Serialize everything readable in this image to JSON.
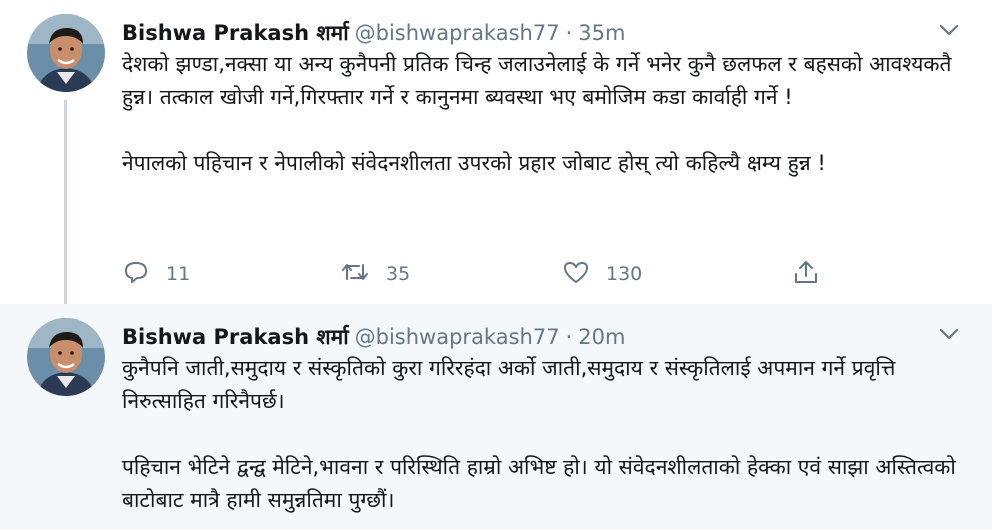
{
  "tweets": [
    {
      "author_name": "Bishwa Prakash शर्मा",
      "handle": "@bishwaprakash77",
      "separator": "·",
      "time": "35m",
      "paragraphs": [
        "देशको झण्डा,नक्सा या अन्य कुनैपनी प्रतिक चिन्ह जलाउनेलाई के गर्ने भनेर कुनै छलफल र बहसको आवश्यकतै हुन्न। तत्काल खोजी गर्ने,गिरफ्तार गर्ने र कानुनमा ब्यवस्था भए बमोजिम कडा कार्वाही गर्ने !",
        "नेपालको पहिचान र नेपालीको संवेदनशीलता उपरको प्रहार जोबाट होस् त्यो कहिल्यै क्षम्य हुन्न !"
      ],
      "replies": "11",
      "retweets": "35",
      "likes": "130"
    },
    {
      "author_name": "Bishwa Prakash शर्मा",
      "handle": "@bishwaprakash77",
      "separator": "·",
      "time": "20m",
      "paragraphs": [
        "कुनैपनि जाती,समुदाय र संस्कृतिको कुरा गरिरहंदा अर्को जाती,समुदाय र संस्कृतिलाई अपमान गर्ने प्रवृत्ति निरुत्साहित गरिनैपर्छ।",
        "पहिचान भेटिने द्वन्द्व मेटिने,भावना र परिस्थिति हाम्रो अभिष्ट हो। यो संवेदनशीलताको हेक्का एवं साझा अस्तित्वको बाटोबाट मात्रै हामी समुन्नतिमा पुग्छौं।"
      ]
    }
  ],
  "icons": {
    "reply": "reply-icon",
    "retweet": "retweet-icon",
    "like": "heart-icon",
    "share": "share-icon",
    "caret": "chevron-down-icon"
  },
  "colors": {
    "text": "#14171a",
    "muted": "#657786",
    "thread_line": "#ccd6dd",
    "highlight_bg": "#f5f8fa"
  }
}
